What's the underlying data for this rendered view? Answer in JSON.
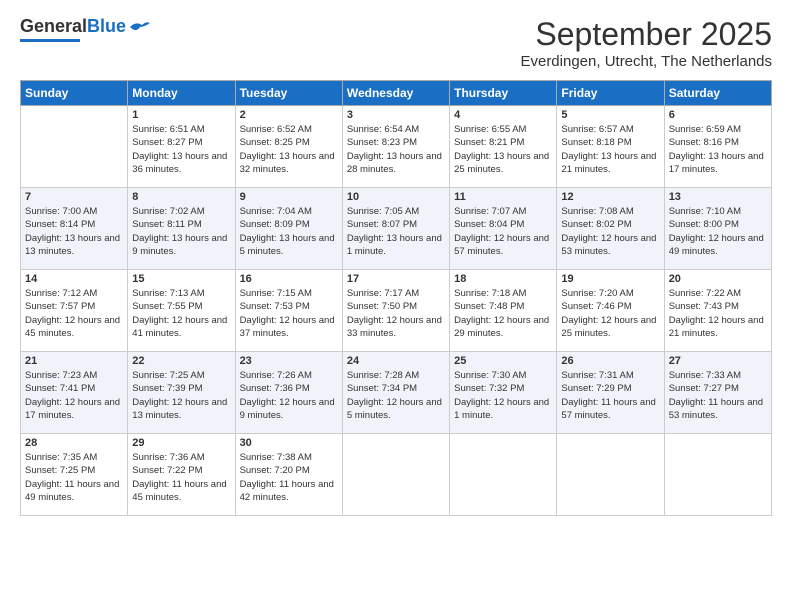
{
  "header": {
    "logo_general": "General",
    "logo_blue": "Blue",
    "month_title": "September 2025",
    "location": "Everdingen, Utrecht, The Netherlands"
  },
  "days_of_week": [
    "Sunday",
    "Monday",
    "Tuesday",
    "Wednesday",
    "Thursday",
    "Friday",
    "Saturday"
  ],
  "weeks": [
    [
      {
        "day": "",
        "empty": true
      },
      {
        "day": "1",
        "sunrise": "6:51 AM",
        "sunset": "8:27 PM",
        "daylight": "13 hours and 36 minutes."
      },
      {
        "day": "2",
        "sunrise": "6:52 AM",
        "sunset": "8:25 PM",
        "daylight": "13 hours and 32 minutes."
      },
      {
        "day": "3",
        "sunrise": "6:54 AM",
        "sunset": "8:23 PM",
        "daylight": "13 hours and 28 minutes."
      },
      {
        "day": "4",
        "sunrise": "6:55 AM",
        "sunset": "8:21 PM",
        "daylight": "13 hours and 25 minutes."
      },
      {
        "day": "5",
        "sunrise": "6:57 AM",
        "sunset": "8:18 PM",
        "daylight": "13 hours and 21 minutes."
      },
      {
        "day": "6",
        "sunrise": "6:59 AM",
        "sunset": "8:16 PM",
        "daylight": "13 hours and 17 minutes."
      }
    ],
    [
      {
        "day": "7",
        "sunrise": "7:00 AM",
        "sunset": "8:14 PM",
        "daylight": "13 hours and 13 minutes."
      },
      {
        "day": "8",
        "sunrise": "7:02 AM",
        "sunset": "8:11 PM",
        "daylight": "13 hours and 9 minutes."
      },
      {
        "day": "9",
        "sunrise": "7:04 AM",
        "sunset": "8:09 PM",
        "daylight": "13 hours and 5 minutes."
      },
      {
        "day": "10",
        "sunrise": "7:05 AM",
        "sunset": "8:07 PM",
        "daylight": "13 hours and 1 minute."
      },
      {
        "day": "11",
        "sunrise": "7:07 AM",
        "sunset": "8:04 PM",
        "daylight": "12 hours and 57 minutes."
      },
      {
        "day": "12",
        "sunrise": "7:08 AM",
        "sunset": "8:02 PM",
        "daylight": "12 hours and 53 minutes."
      },
      {
        "day": "13",
        "sunrise": "7:10 AM",
        "sunset": "8:00 PM",
        "daylight": "12 hours and 49 minutes."
      }
    ],
    [
      {
        "day": "14",
        "sunrise": "7:12 AM",
        "sunset": "7:57 PM",
        "daylight": "12 hours and 45 minutes."
      },
      {
        "day": "15",
        "sunrise": "7:13 AM",
        "sunset": "7:55 PM",
        "daylight": "12 hours and 41 minutes."
      },
      {
        "day": "16",
        "sunrise": "7:15 AM",
        "sunset": "7:53 PM",
        "daylight": "12 hours and 37 minutes."
      },
      {
        "day": "17",
        "sunrise": "7:17 AM",
        "sunset": "7:50 PM",
        "daylight": "12 hours and 33 minutes."
      },
      {
        "day": "18",
        "sunrise": "7:18 AM",
        "sunset": "7:48 PM",
        "daylight": "12 hours and 29 minutes."
      },
      {
        "day": "19",
        "sunrise": "7:20 AM",
        "sunset": "7:46 PM",
        "daylight": "12 hours and 25 minutes."
      },
      {
        "day": "20",
        "sunrise": "7:22 AM",
        "sunset": "7:43 PM",
        "daylight": "12 hours and 21 minutes."
      }
    ],
    [
      {
        "day": "21",
        "sunrise": "7:23 AM",
        "sunset": "7:41 PM",
        "daylight": "12 hours and 17 minutes."
      },
      {
        "day": "22",
        "sunrise": "7:25 AM",
        "sunset": "7:39 PM",
        "daylight": "12 hours and 13 minutes."
      },
      {
        "day": "23",
        "sunrise": "7:26 AM",
        "sunset": "7:36 PM",
        "daylight": "12 hours and 9 minutes."
      },
      {
        "day": "24",
        "sunrise": "7:28 AM",
        "sunset": "7:34 PM",
        "daylight": "12 hours and 5 minutes."
      },
      {
        "day": "25",
        "sunrise": "7:30 AM",
        "sunset": "7:32 PM",
        "daylight": "12 hours and 1 minute."
      },
      {
        "day": "26",
        "sunrise": "7:31 AM",
        "sunset": "7:29 PM",
        "daylight": "11 hours and 57 minutes."
      },
      {
        "day": "27",
        "sunrise": "7:33 AM",
        "sunset": "7:27 PM",
        "daylight": "11 hours and 53 minutes."
      }
    ],
    [
      {
        "day": "28",
        "sunrise": "7:35 AM",
        "sunset": "7:25 PM",
        "daylight": "11 hours and 49 minutes."
      },
      {
        "day": "29",
        "sunrise": "7:36 AM",
        "sunset": "7:22 PM",
        "daylight": "11 hours and 45 minutes."
      },
      {
        "day": "30",
        "sunrise": "7:38 AM",
        "sunset": "7:20 PM",
        "daylight": "11 hours and 42 minutes."
      },
      {
        "day": "",
        "empty": true
      },
      {
        "day": "",
        "empty": true
      },
      {
        "day": "",
        "empty": true
      },
      {
        "day": "",
        "empty": true
      }
    ]
  ],
  "labels": {
    "sunrise_prefix": "Sunrise: ",
    "sunset_prefix": "Sunset: ",
    "daylight_prefix": "Daylight: "
  }
}
